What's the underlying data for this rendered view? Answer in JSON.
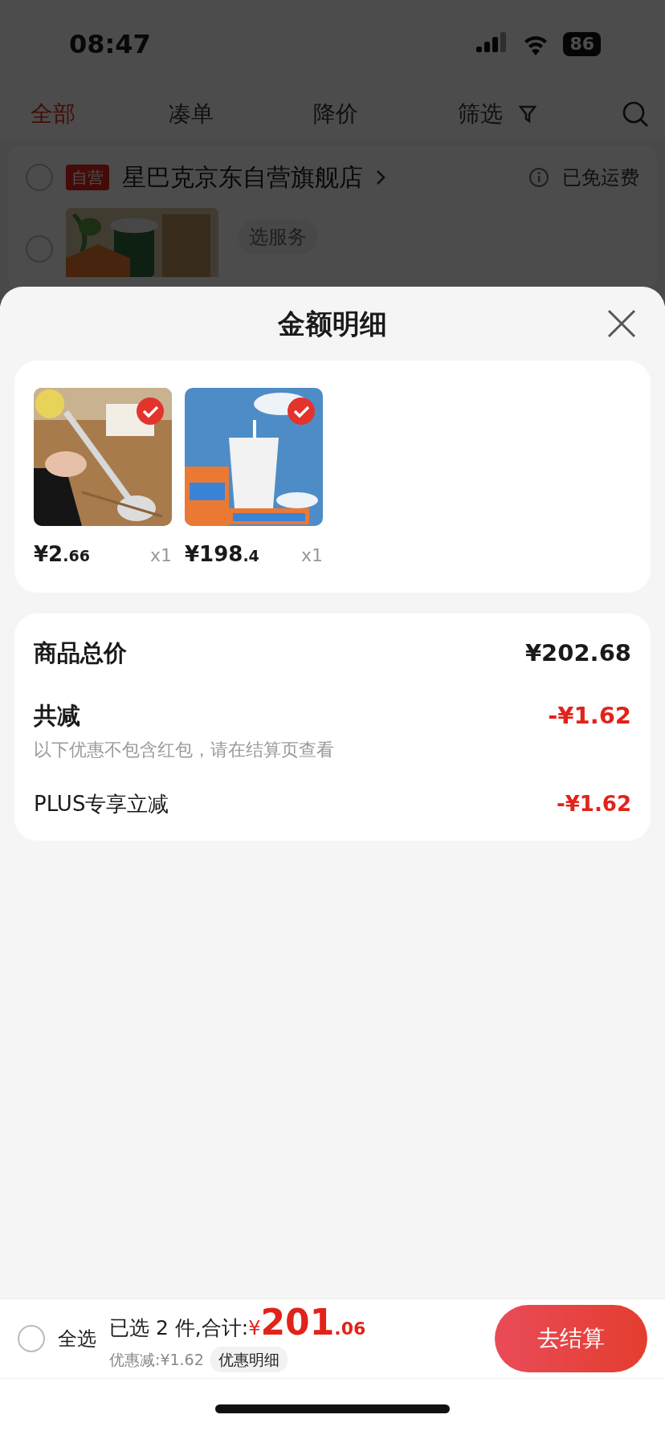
{
  "status_bar": {
    "time": "08:47",
    "battery": "86"
  },
  "tabs": [
    {
      "label": "全部",
      "selected": true,
      "kind": "plain"
    },
    {
      "label": "凑单",
      "selected": false,
      "kind": "plain"
    },
    {
      "label": "降价",
      "selected": false,
      "kind": "plain"
    },
    {
      "label": "筛选",
      "selected": false,
      "kind": "filter"
    }
  ],
  "store": {
    "badge": "自营",
    "name": "星巴克京东自营旗舰店",
    "shipping": "已免运费",
    "selected": false
  },
  "cart_item": {
    "selected": false,
    "service": "选服务"
  },
  "sheet": {
    "title": "金额明细",
    "items": [
      {
        "price_int": "¥2",
        "price_dec": ".66",
        "quantity": "x1",
        "selected": true,
        "kind": "spoon"
      },
      {
        "price_int": "¥198",
        "price_dec": ".4",
        "quantity": "x1",
        "selected": true,
        "kind": "cup"
      }
    ],
    "rows": [
      {
        "kind": "total",
        "label": "商品总价",
        "value": "¥202.68"
      },
      {
        "kind": "discount",
        "label": "共减",
        "value": "-¥1.62",
        "note": "以下优惠不包含红包，请在结算页查看"
      },
      {
        "kind": "item",
        "label": "PLUS专享立减",
        "value": "-¥1.62"
      }
    ]
  },
  "footer": {
    "select_all": {
      "label": "全选",
      "checked": false
    },
    "summary": "已选 2 件,合计:",
    "currency": "¥",
    "total_int": "201",
    "total_dec": ".06",
    "discount": "优惠减:¥1.62",
    "detail_link": "优惠明细",
    "checkout": "去结算"
  }
}
